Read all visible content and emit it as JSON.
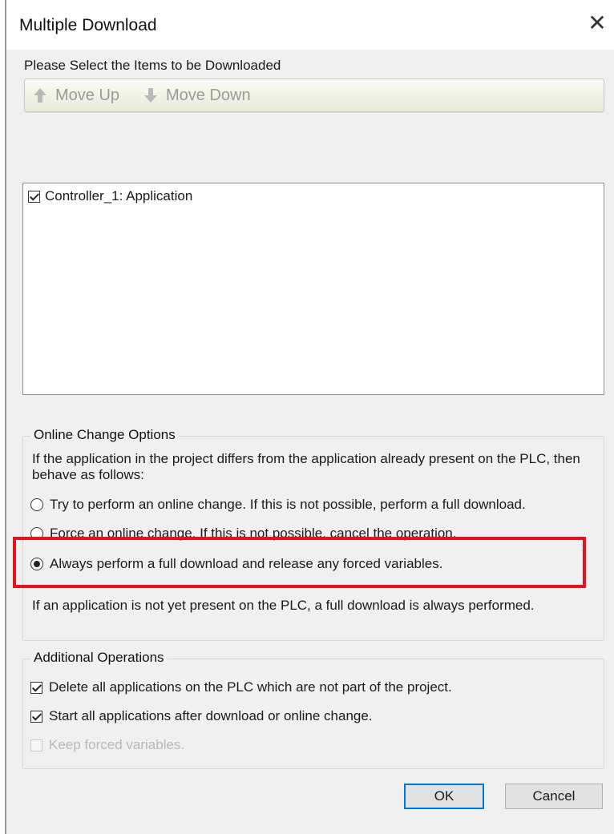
{
  "dialog": {
    "title": "Multiple Download",
    "close_icon": "close-icon"
  },
  "items_section": {
    "label": "Please Select the Items to be Downloaded",
    "toolbar": {
      "move_up_label": "Move Up",
      "move_up_icon": "arrow-up-icon",
      "move_down_label": "Move Down",
      "move_down_icon": "arrow-down-icon"
    },
    "items": [
      {
        "label": "Controller_1:  Application",
        "checked": true
      }
    ]
  },
  "online_change": {
    "legend": "Online Change Options",
    "description": "If the application in the project differs from the application already present on the PLC, then behave as follows:",
    "options": [
      {
        "label": "Try to perform an online change. If this is not possible, perform a full download.",
        "selected": false
      },
      {
        "label": "Force an online change. If this is not possible, cancel the operation.",
        "selected": false
      },
      {
        "label": "Always perform a full download and release any forced variables.",
        "selected": true
      }
    ],
    "note": "If an application is not yet present on the PLC, a full download is always performed.",
    "highlight_color": "#e3141b"
  },
  "additional_operations": {
    "legend": "Additional Operations",
    "options": [
      {
        "label": "Delete all applications on the PLC which are not part of the project.",
        "checked": true,
        "enabled": true
      },
      {
        "label": "Start all applications after download or online change.",
        "checked": true,
        "enabled": true
      },
      {
        "label": "Keep forced variables.",
        "checked": false,
        "enabled": false
      }
    ]
  },
  "buttons": {
    "ok_label": "OK",
    "cancel_label": "Cancel",
    "default_border_color": "#0078d7"
  }
}
